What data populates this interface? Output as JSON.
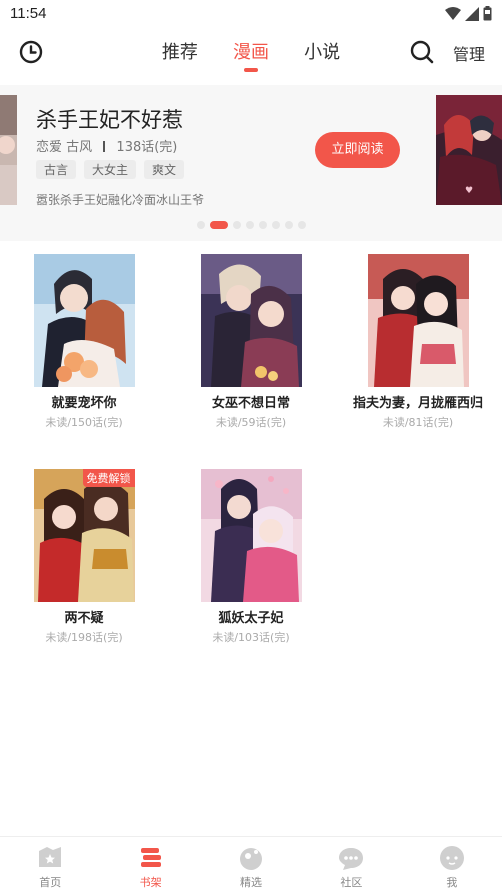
{
  "status_bar": {
    "time": "11:54"
  },
  "header": {
    "tabs": [
      {
        "label": "推荐"
      },
      {
        "label": "漫画"
      },
      {
        "label": "小说"
      }
    ],
    "active_tab": 1,
    "manage_label": "管理"
  },
  "banner": {
    "title": "杀手王妃不好惹",
    "genres": "恋爱 古风",
    "chapters": "138话(完)",
    "tags": [
      "古言",
      "大女主",
      "爽文"
    ],
    "description": "嚣张杀手王妃融化冷面冰山王爷",
    "read_button": "立即阅读",
    "dot_count": 8,
    "active_dot": 1
  },
  "comics": [
    {
      "title": "就要宠坏你",
      "status": "未读/150话(完)"
    },
    {
      "title": "女巫不想日常",
      "status": "未读/59话(完)"
    },
    {
      "title": "指夫为妻，月拢雁西归",
      "status": "未读/81话(完)"
    },
    {
      "title": "两不疑",
      "status": "未读/198话(完)",
      "badge": "免费解锁"
    },
    {
      "title": "狐妖太子妃",
      "status": "未读/103话(完)"
    }
  ],
  "bottom_nav": [
    {
      "label": "首页",
      "icon": "home-icon"
    },
    {
      "label": "书架",
      "icon": "bookshelf-icon"
    },
    {
      "label": "精选",
      "icon": "featured-icon"
    },
    {
      "label": "社区",
      "icon": "community-icon"
    },
    {
      "label": "我",
      "icon": "profile-icon"
    }
  ],
  "active_nav": 1,
  "colors": {
    "accent": "#f2564a",
    "banner_bg": "#f7f7f7",
    "muted": "#aaaaaa"
  }
}
